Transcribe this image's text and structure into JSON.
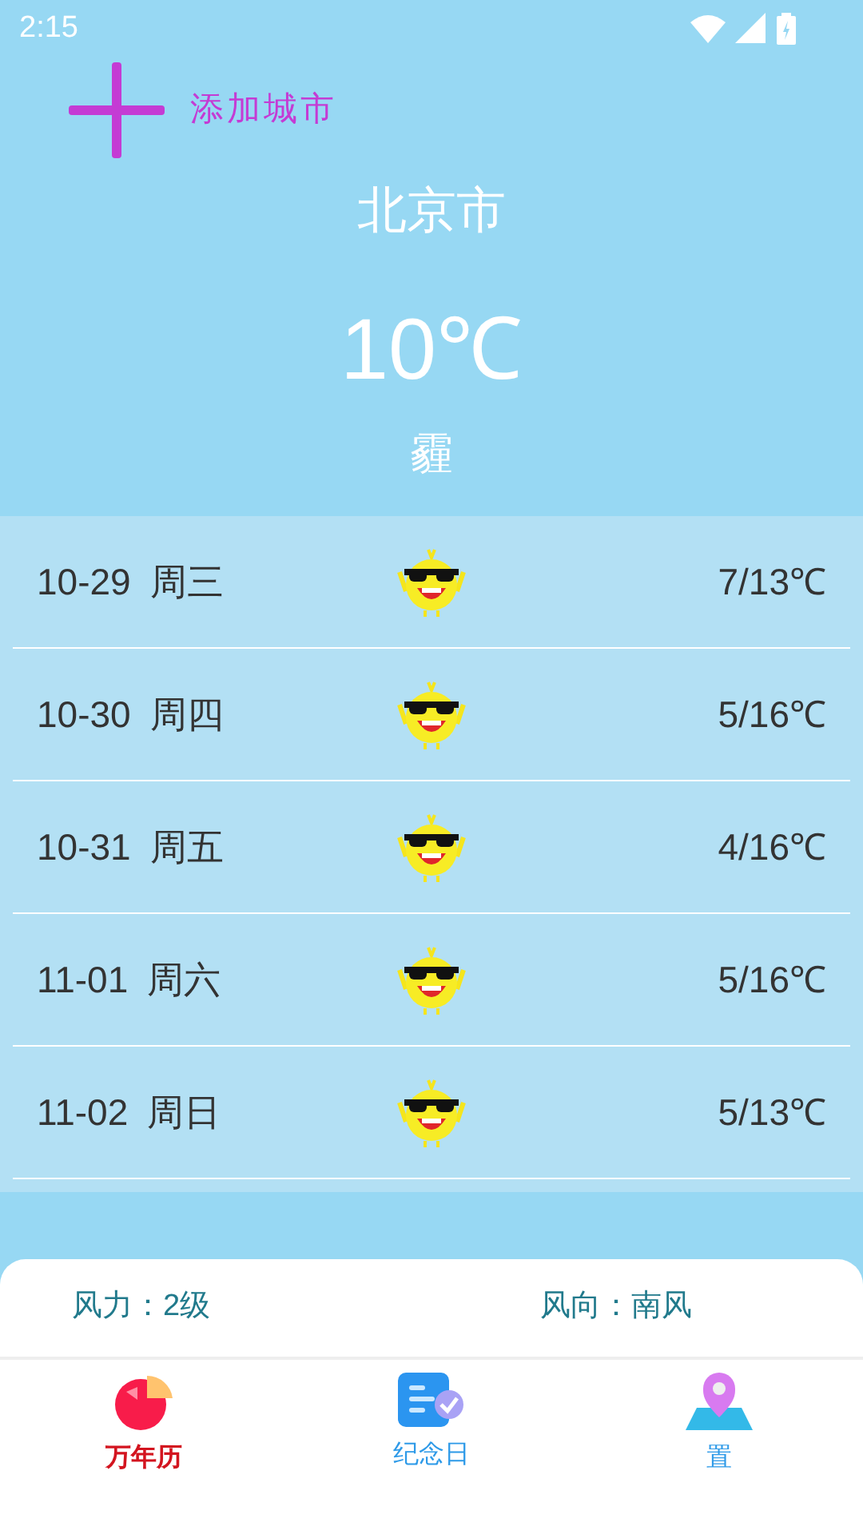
{
  "status_bar": {
    "time": "2:15"
  },
  "add_city": {
    "label": "添加城市"
  },
  "city": "北京市",
  "temperature": "10℃",
  "condition": "霾",
  "forecast": [
    {
      "date": "10-29",
      "weekday": "周三",
      "range": "7/13℃"
    },
    {
      "date": "10-30",
      "weekday": "周四",
      "range": "5/16℃"
    },
    {
      "date": "10-31",
      "weekday": "周五",
      "range": "4/16℃"
    },
    {
      "date": "11-01",
      "weekday": "周六",
      "range": "5/16℃"
    },
    {
      "date": "11-02",
      "weekday": "周日",
      "range": "5/13℃"
    }
  ],
  "wind": {
    "force": "风力：2级",
    "direction": "风向：南风"
  },
  "bottom_nav": [
    {
      "label": "万年历",
      "kind": "calendar",
      "selected": true
    },
    {
      "label": "纪念日",
      "kind": "anniversary",
      "selected": false
    },
    {
      "label": "置",
      "kind": "location",
      "selected": false
    }
  ]
}
